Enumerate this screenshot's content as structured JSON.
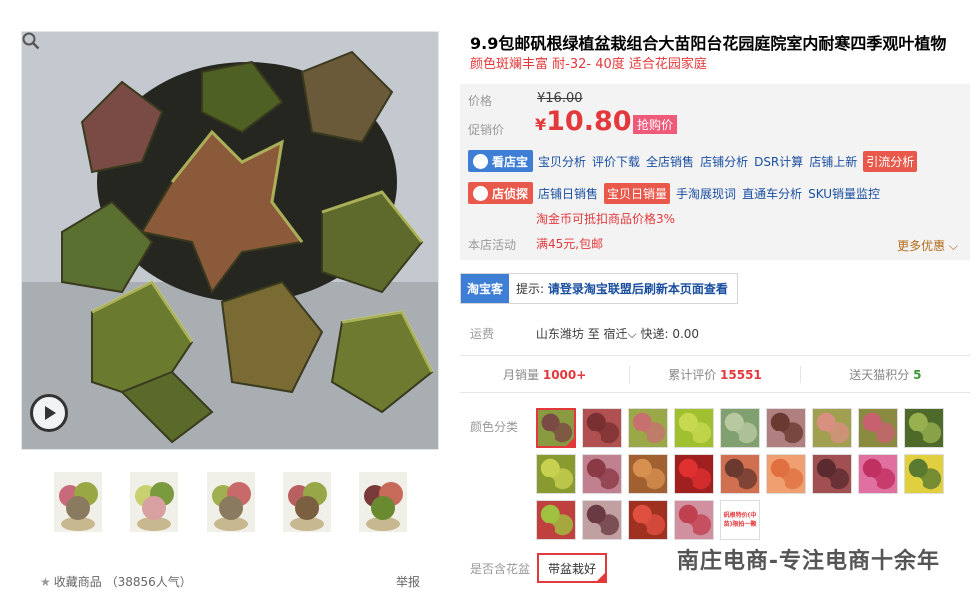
{
  "product": {
    "title": "9.9包邮矾根绿植盆栽组合大苗阳台花园庭院室内耐寒四季观叶植物",
    "subtitle": "颜色斑斓丰富 耐-32- 40度 适合花园家庭"
  },
  "gallery": {
    "thumb_count": 5,
    "favorite_label": "收藏商品",
    "favorite_count": "（38856人气）",
    "report_label": "举报"
  },
  "price": {
    "price_label": "价格",
    "original_price": "¥16.00",
    "promo_label": "促销价",
    "currency": "¥",
    "promo_price": "10.80",
    "promo_badge": "抢购价"
  },
  "tools": {
    "kandianbao_label": "看店宝",
    "row1_links": [
      "宝贝分析",
      "评价下载",
      "全店销售",
      "店铺分析",
      "DSR计算",
      "店铺上新"
    ],
    "row1_highlight": "引流分析",
    "dianzhentan_label": "店侦探",
    "row2_first": "店铺日销售",
    "row2_highlight": "宝贝日销量",
    "row2_links": [
      "手淘展现词",
      "直通车分析",
      "SKU销量监控"
    ],
    "coin_note": "淘金币可抵扣商品价格3%"
  },
  "shop_activity": {
    "label": "本店活动",
    "value": "满45元,包邮",
    "more": "更多优惠"
  },
  "taobaoke": {
    "tag": "淘宝客",
    "hint_prefix": "提示:",
    "hint_text": "请登录淘宝联盟后刷新本页面查看"
  },
  "shipping": {
    "label": "运费",
    "from": "山东潍坊",
    "to_word": "至",
    "to": "宿迁",
    "express": "快递: 0.00"
  },
  "stats": {
    "monthly_label": "月销量",
    "monthly_value": "1000+",
    "reviews_label": "累计评价",
    "reviews_value": "15551",
    "points_label": "送天猫积分",
    "points_value": "5"
  },
  "sku": {
    "color_label": "颜色分类",
    "special_swatch_text": "矾根特价(中苗)限拍一颗",
    "pot_label": "是否含花盆",
    "pot_option": "带盆栽好"
  },
  "watermark": "南庄电商-专注电商十余年",
  "colors": {
    "accent_red": "#e4393c",
    "link_blue": "#1a4fa0",
    "badge_blue": "#3e7ed4",
    "badge_red": "#e9594b"
  }
}
